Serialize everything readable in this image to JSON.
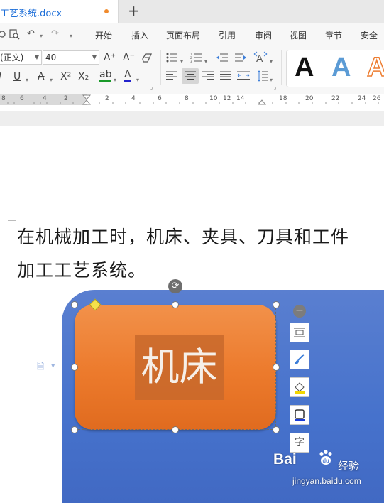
{
  "tab": {
    "title": "工艺系统.docx",
    "new_tab": "+"
  },
  "menu": [
    "开始",
    "插入",
    "页面布局",
    "引用",
    "审阅",
    "视图",
    "章节",
    "安全"
  ],
  "quick": {
    "undo": "↶",
    "redo": "↷"
  },
  "font": {
    "name": "(正文)",
    "size": "40"
  },
  "tools": {
    "grow": "A⁺",
    "shrink": "A⁻",
    "clear": "⌫",
    "italic": "I",
    "underline": "U",
    "strike": "A",
    "superscript": "X²",
    "subscript": "X₂",
    "highlight": "ab",
    "font_color": "A",
    "style_a": "A"
  },
  "ruler": [
    "8",
    "6",
    "4",
    "2",
    "2",
    "4",
    "6",
    "8",
    "10",
    "12",
    "14",
    "18",
    "20",
    "22",
    "24",
    "26"
  ],
  "body": {
    "line1": "在机械加工时，机床、夹具、刀具和工件",
    "line2": "加工工艺系统。"
  },
  "shape": {
    "text": "机床"
  },
  "float_toolbar": [
    "collapse",
    "layout",
    "fill",
    "outline",
    "border",
    "text"
  ],
  "float_toolbar_text_label": "字",
  "watermark": {
    "logo": "Bai",
    "logo2": "经验",
    "url": "jingyan.baidu.com"
  },
  "colors": {
    "blue": "#4672cc",
    "orange": "#ec7a2c",
    "tab_accent": "#1e6fd9"
  }
}
